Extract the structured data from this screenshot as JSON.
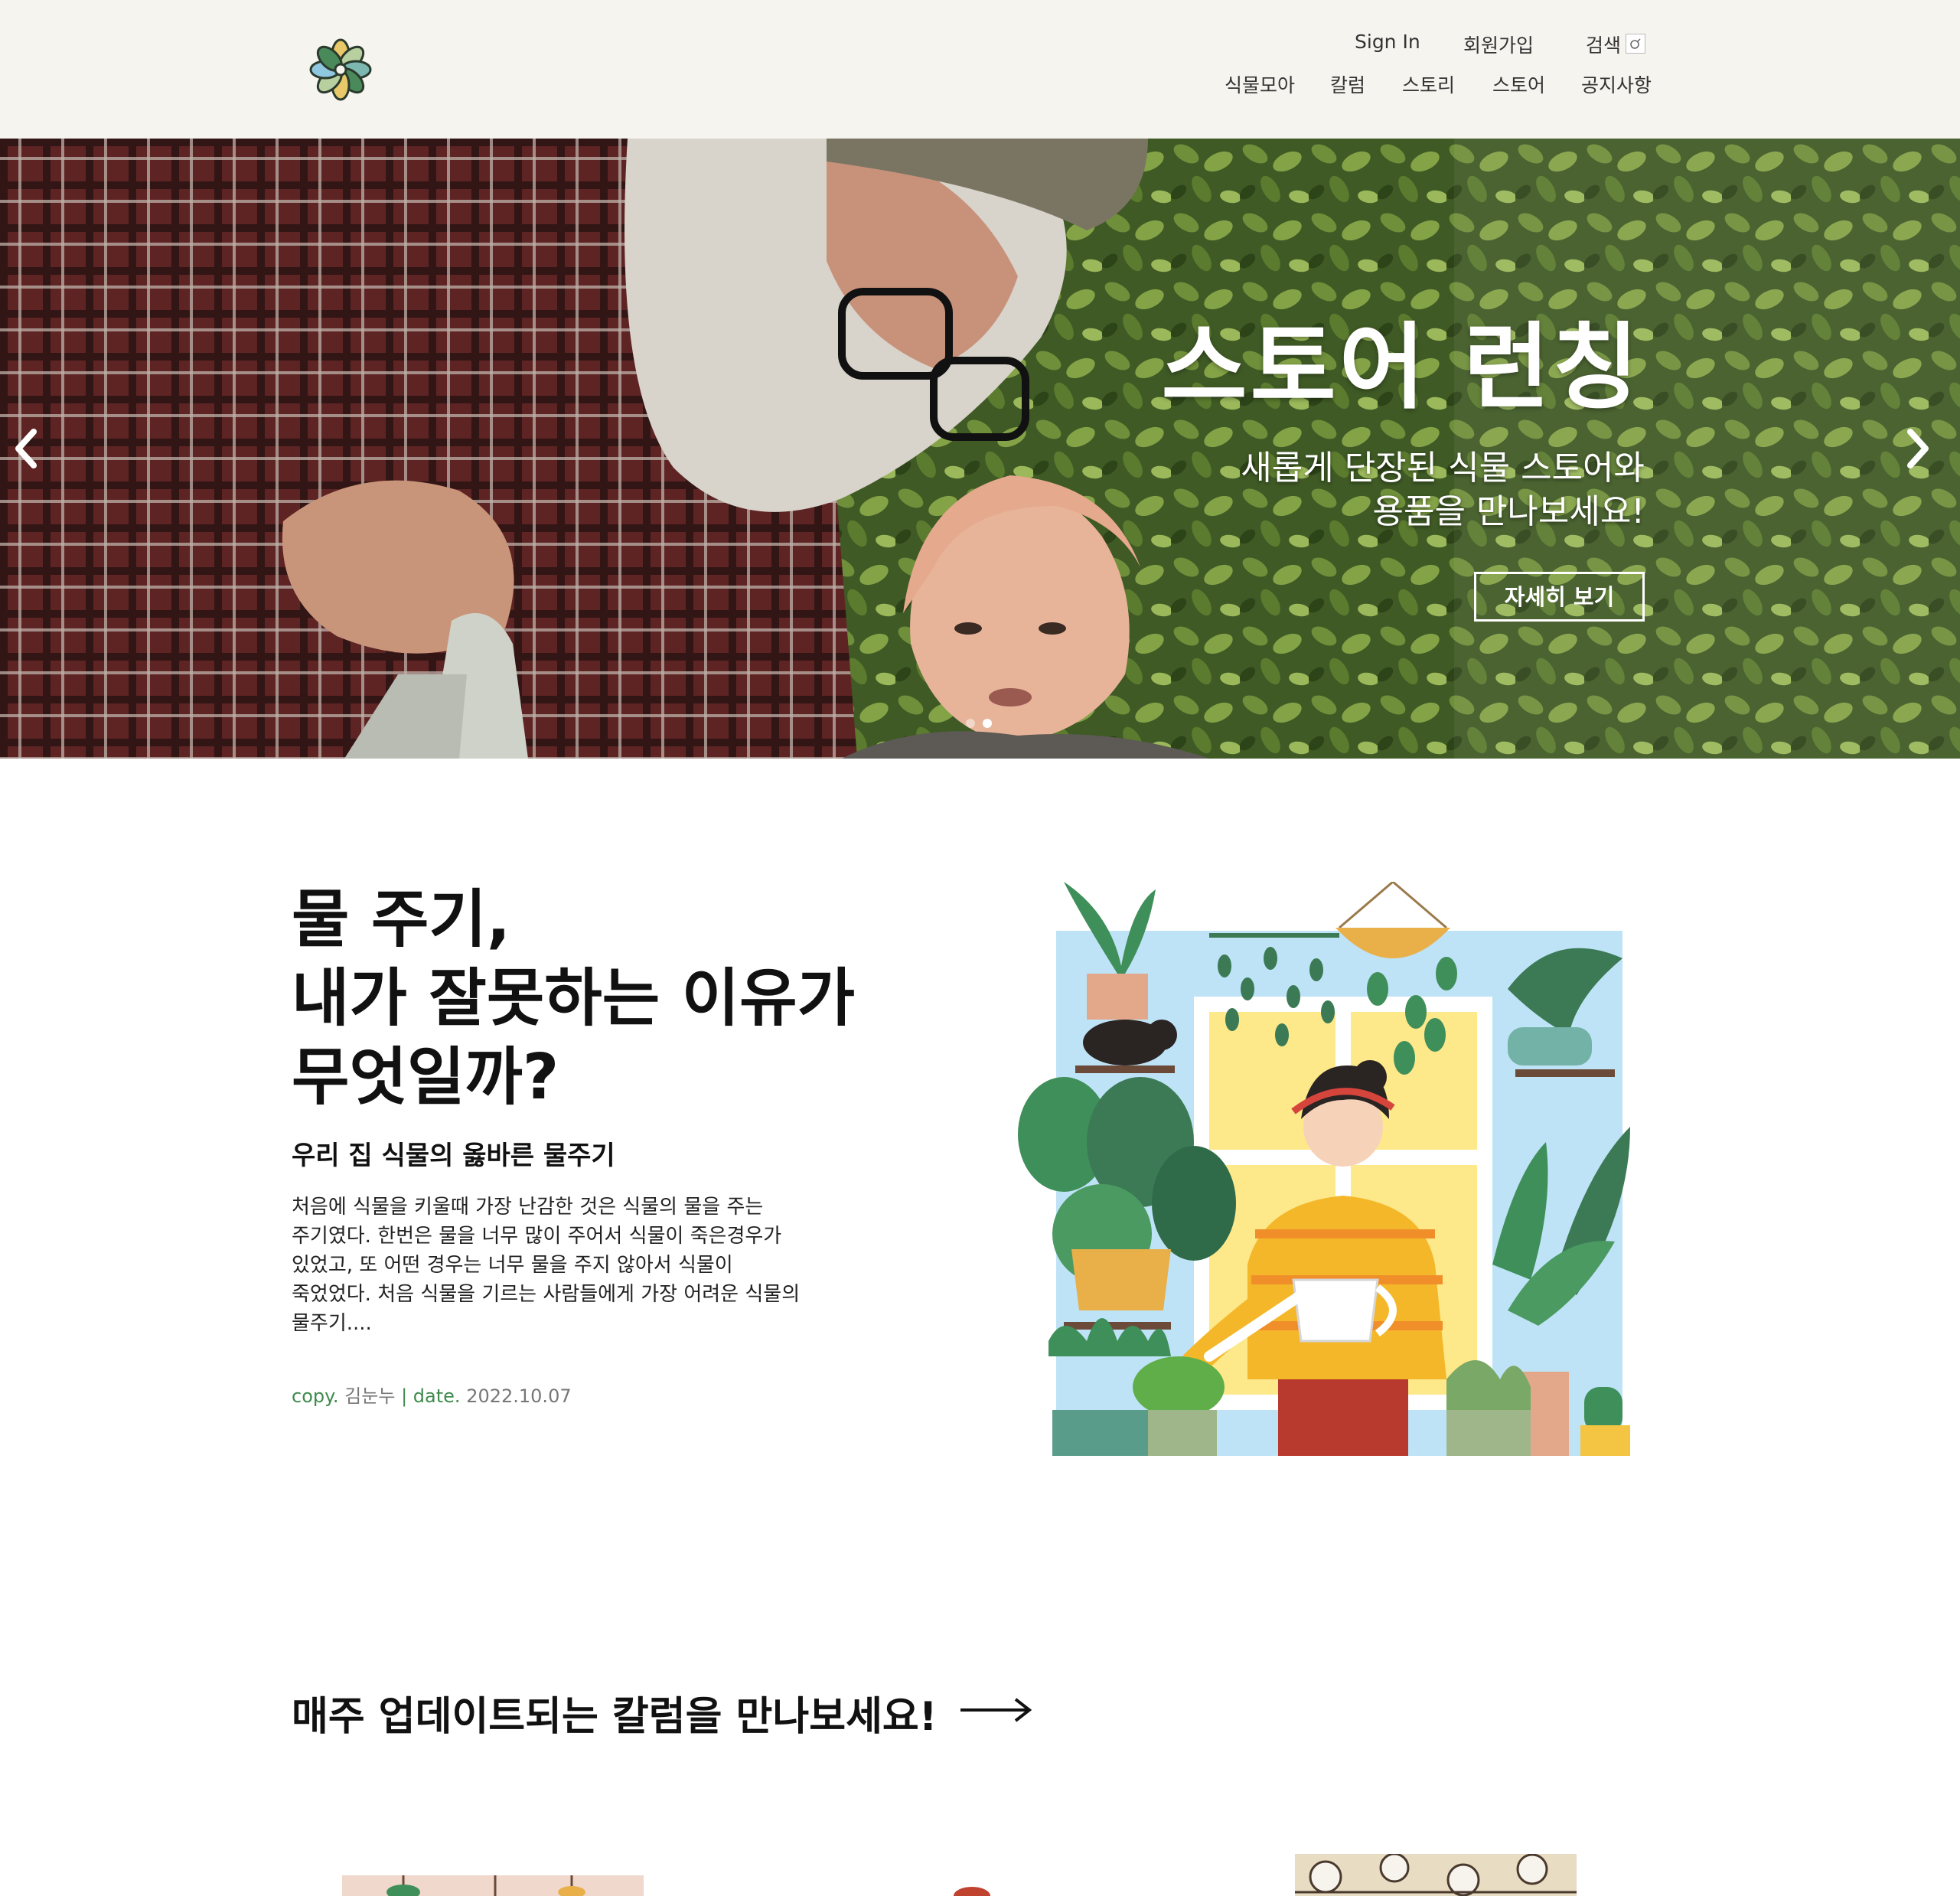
{
  "header": {
    "top_links": [
      "Sign In",
      "회원가입",
      "검색"
    ],
    "nav": [
      "식물모아",
      "칼럼",
      "스토리",
      "스토어",
      "공지사항"
    ],
    "logo_icon": "clover-logo",
    "search_icon": "search-icon"
  },
  "hero": {
    "title": "스토어 런칭",
    "subtitle_lines": [
      "새롭게 단장된 식물 스토어와",
      "용품을 만나보세요!"
    ],
    "button": "자세히 보기",
    "prev_icon": "chevron-left-icon",
    "next_icon": "chevron-right-icon",
    "slide_count": 2,
    "active_slide": 2
  },
  "article": {
    "title_lines": [
      "물 주기,",
      "내가 잘못하는 이유가",
      "무엇일까?"
    ],
    "subtitle": "우리 집 식물의 옳바른 물주기",
    "body_lines": [
      "처음에 식물을 키울때 가장 난감한 것은 식물의 물을 주는",
      "주기였다. 한번은 물을 너무 많이 주어서 식물이 죽은경우가",
      "있었고, 또 어떤 경우는 너무 물을 주지 않아서 식물이",
      "죽었었다. 처음 식물을 기르는 사람들에게 가장 어려운 식물의",
      "물주기...."
    ],
    "copy_label": "copy.",
    "author": "김눈누",
    "separator": "|",
    "date_label": "date.",
    "date": "2022.10.07"
  },
  "columns": {
    "heading": "매주 업데이트되는 칼럼을 만나보세요!",
    "arrow_icon": "arrow-right-icon"
  },
  "colors": {
    "header_bg": "#f6f4ef",
    "accent_green": "#3f8a4d",
    "text": "#111111"
  }
}
